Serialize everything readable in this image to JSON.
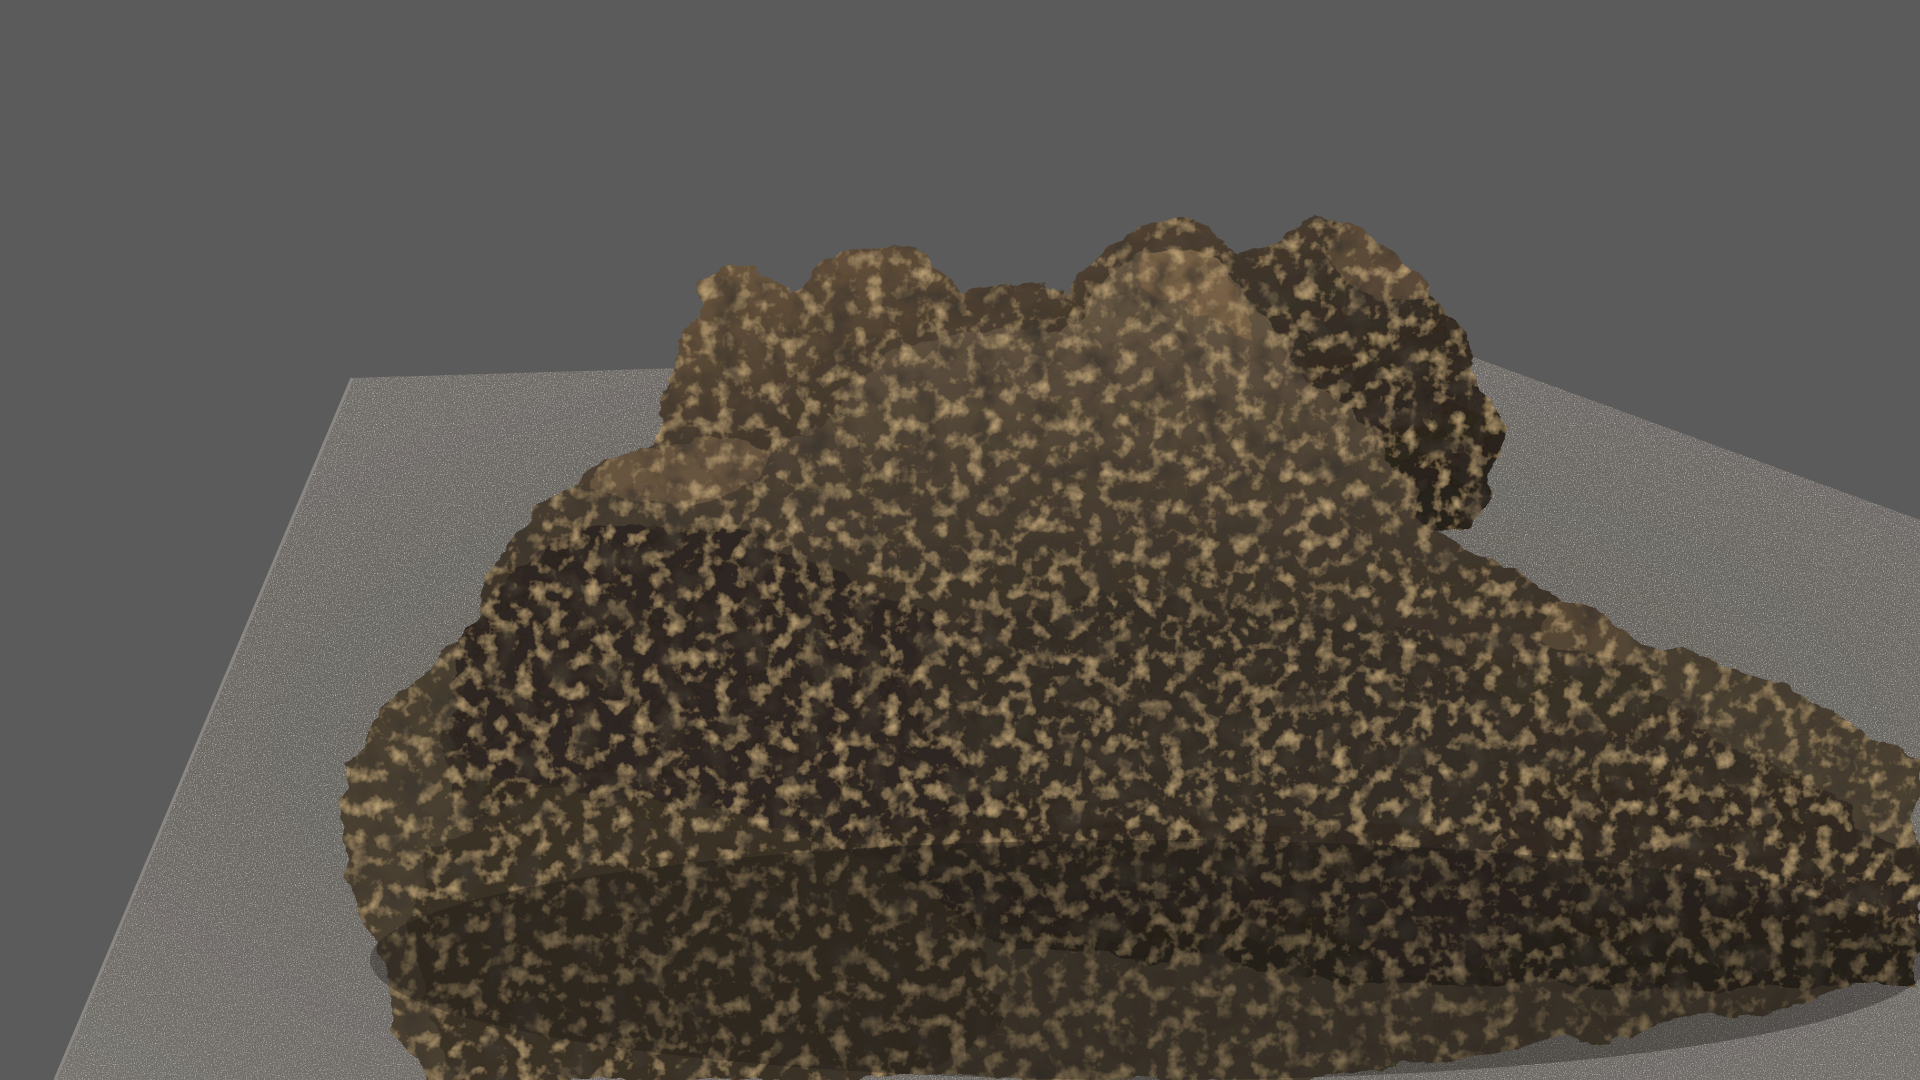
{
  "viewport": {
    "background_color": "#5a5a5a",
    "ground_color": "#6b6866",
    "ground_highlight_color": "#bdbab4",
    "rock_dark_color": "#1f1b16",
    "rock_mid_color": "#3d342a",
    "rock_light_color": "#6f5a40",
    "rock_ochre_color": "#9a6d3a"
  },
  "scene": {
    "subject": "rock-formation",
    "surface": "ground-plane"
  }
}
